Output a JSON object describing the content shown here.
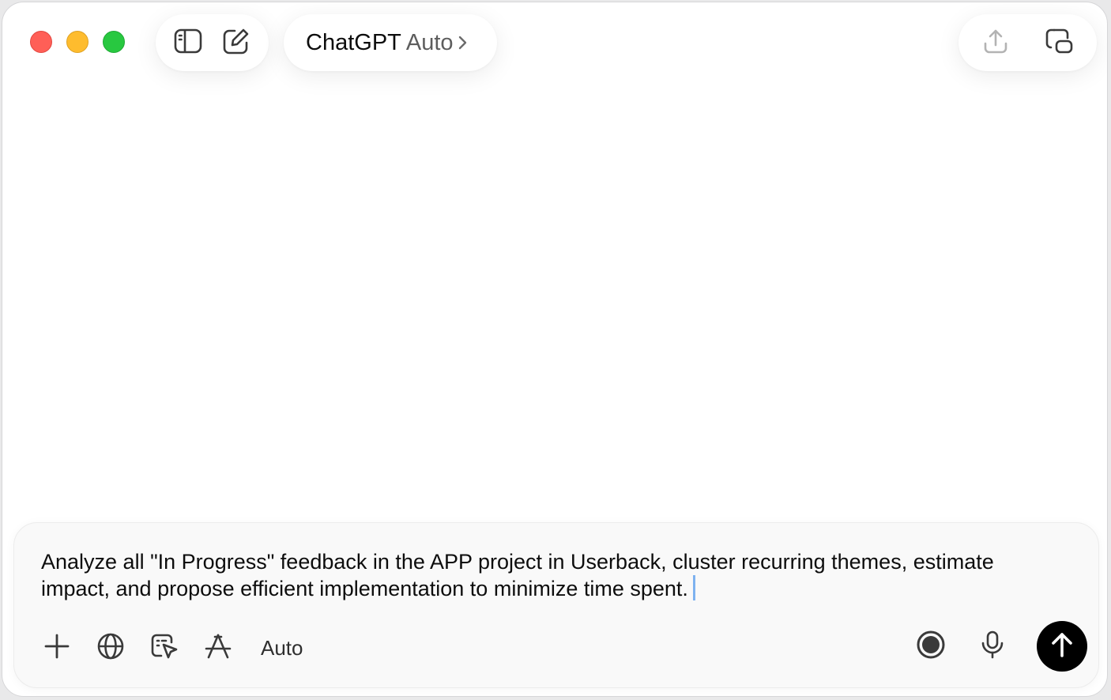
{
  "window": {
    "traffic_lights": {
      "close": "#ff5f57",
      "minimize": "#febc2e",
      "zoom": "#28c840"
    }
  },
  "toolbar": {
    "left_icons": [
      "sidebar-toggle-icon",
      "new-chat-icon"
    ],
    "title": "ChatGPT",
    "model": "Auto",
    "right_icons": [
      "share-icon",
      "popout-window-icon"
    ]
  },
  "composer": {
    "text": "Analyze all \"In Progress\" feedback in the APP project in Userback, cluster recurring themes, estimate impact, and propose efficient implementation to minimize time spent.",
    "mode_label": "Auto",
    "left_icons": [
      "plus-icon",
      "globe-icon",
      "agent-cursor-icon",
      "tools-icon"
    ],
    "right_icons": [
      "voice-mode-icon",
      "microphone-icon",
      "send-arrow-icon"
    ],
    "caret_color": "#7eb2f0",
    "send_button_color": "#000000"
  }
}
